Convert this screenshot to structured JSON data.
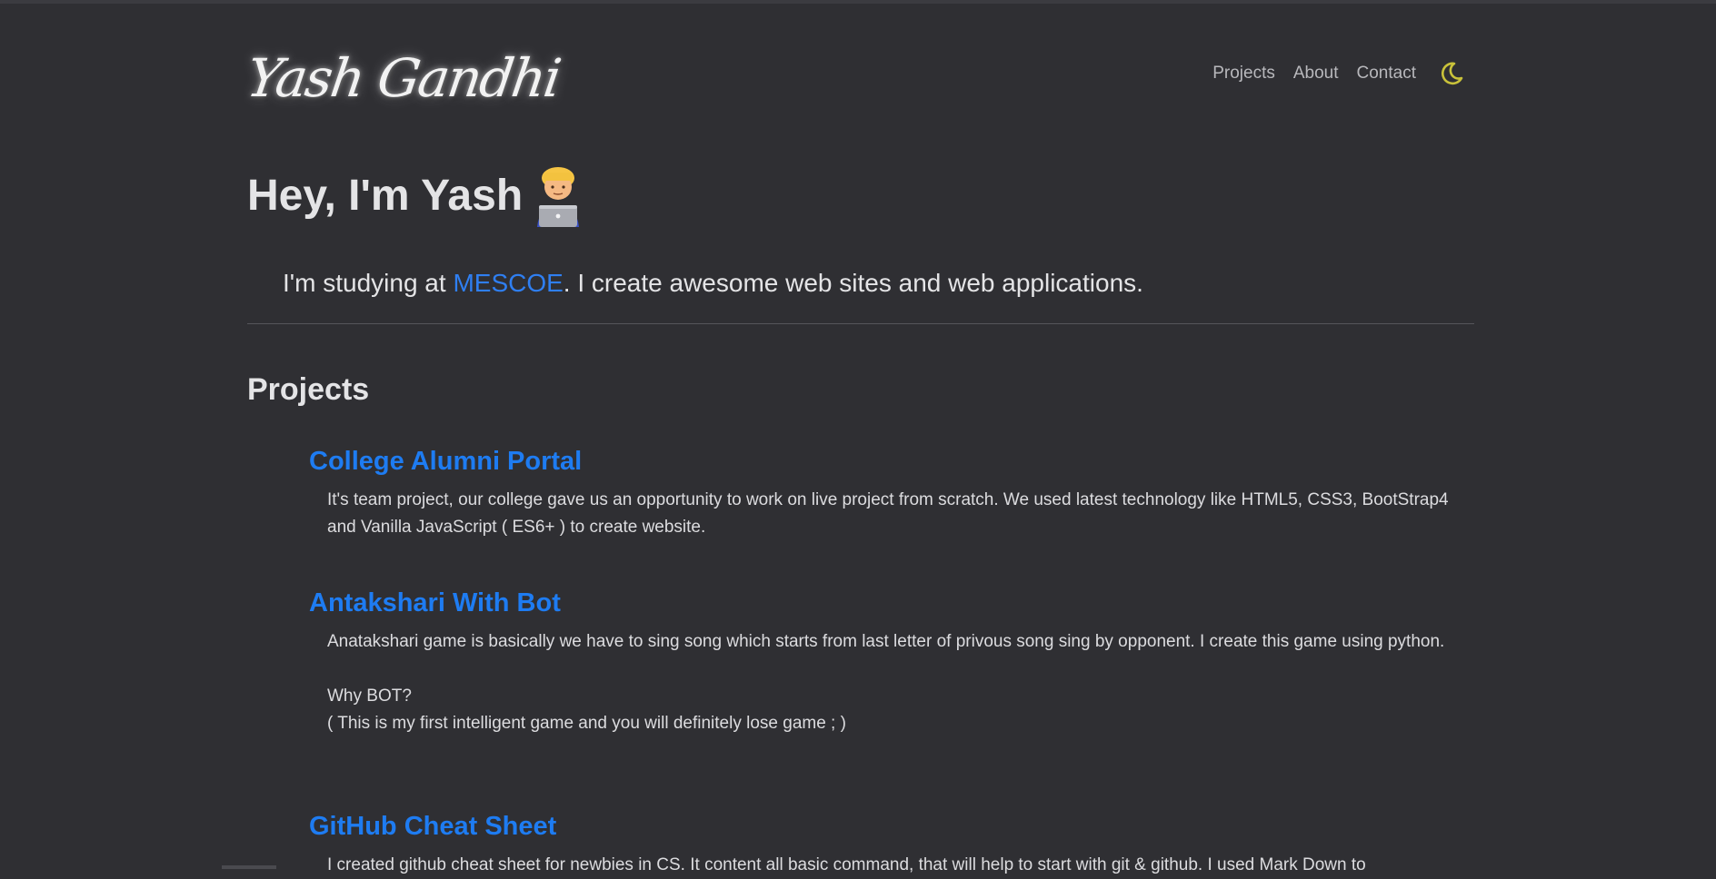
{
  "header": {
    "logo_text": "Yash Gandhi",
    "nav": [
      {
        "label": "Projects"
      },
      {
        "label": "About"
      },
      {
        "label": "Contact"
      }
    ],
    "theme_toggle_icon": "moon-icon",
    "theme_toggle_color": "#c9c23a"
  },
  "hero": {
    "title": "Hey, I'm Yash",
    "emoji_icon": "technologist-emoji",
    "intro_prefix": "I'm studying at ",
    "intro_link": "MESCOE",
    "intro_suffix": ". I create awesome web sites and web applications."
  },
  "projects_section": {
    "title": "Projects",
    "items": [
      {
        "title": "College Alumni Portal",
        "description": "It's team project, our college gave us an opportunity to work on live project from scratch. We used latest technology like HTML5, CSS3, BootStrap4 and Vanilla JavaScript ( ES6+ ) to create website."
      },
      {
        "title": "Antakshari With Bot",
        "description": "Anatakshari game is basically we have to sing song which starts from last letter of privous song sing by opponent. I create this game using python.\n\nWhy BOT?\n( This is my first intelligent game and you will definitely lose game ; )"
      },
      {
        "title": "GitHub Cheat Sheet",
        "description": "I created github cheat sheet for newbies in CS. It content all basic command, that will help to start with git & github. I used Mark Down to"
      }
    ]
  },
  "colors": {
    "background": "#2f2f33",
    "link": "#1e7cf2",
    "text": "#e4e4e6"
  }
}
